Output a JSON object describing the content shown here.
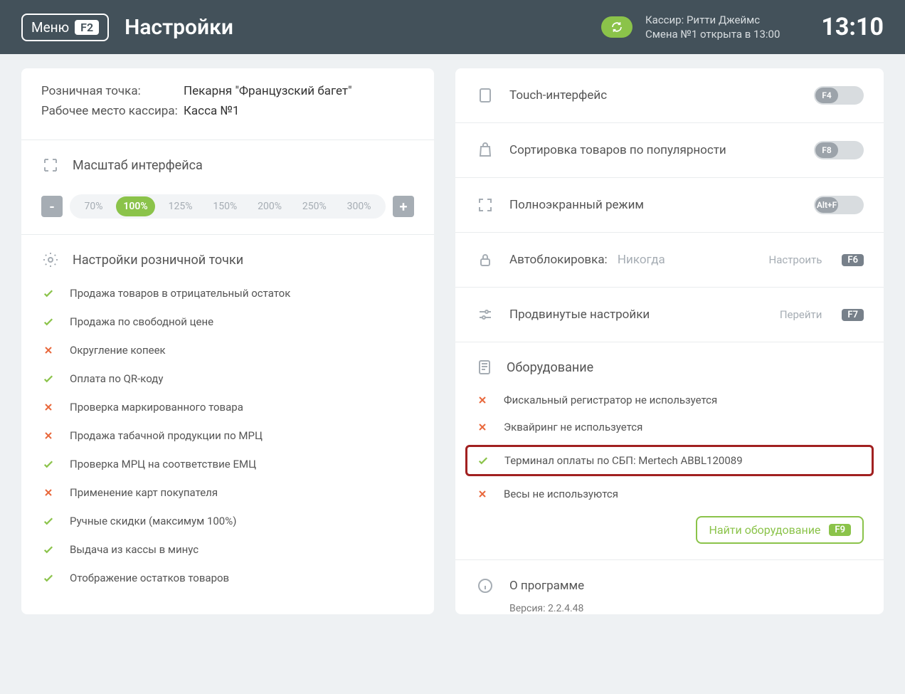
{
  "header": {
    "menu_label": "Меню",
    "menu_key": "F2",
    "title": "Настройки",
    "cashier_line1": "Кассир: Ритти Джеймс",
    "cashier_line2": "Смена №1 открыта в 13:00",
    "clock": "13:10"
  },
  "left": {
    "info": {
      "retail_label": "Розничная точка:",
      "retail_value": "Пекарня \"Французский багет\"",
      "workplace_label": "Рабочее место кассира:",
      "workplace_value": "Касса №1"
    },
    "scale": {
      "title": "Масштаб интерфейса",
      "minus": "-",
      "plus": "+",
      "options": [
        "70%",
        "100%",
        "125%",
        "150%",
        "200%",
        "250%",
        "300%"
      ],
      "active_index": 1
    },
    "point_settings": {
      "title": "Настройки розничной точки",
      "items": [
        {
          "ok": true,
          "text": "Продажа товаров в отрицательный остаток"
        },
        {
          "ok": true,
          "text": "Продажа по свободной цене"
        },
        {
          "ok": false,
          "text": "Округление копеек"
        },
        {
          "ok": true,
          "text": "Оплата по QR-коду"
        },
        {
          "ok": false,
          "text": "Проверка маркированного товара"
        },
        {
          "ok": false,
          "text": "Продажа табачной продукции по МРЦ"
        },
        {
          "ok": true,
          "text": "Проверка МРЦ на соответствие ЕМЦ"
        },
        {
          "ok": false,
          "text": "Применение карт покупателя"
        },
        {
          "ok": true,
          "text": "Ручные скидки (максимум 100%)"
        },
        {
          "ok": true,
          "text": "Выдача из кассы в минус"
        },
        {
          "ok": true,
          "text": "Отображение остатков товаров"
        }
      ]
    }
  },
  "right": {
    "touch": {
      "label": "Touch-интерфейс",
      "key": "F4"
    },
    "sort": {
      "label": "Сортировка товаров по популярности",
      "key": "F8"
    },
    "fullscreen": {
      "label": "Полноэкранный режим",
      "key": "Alt+F"
    },
    "autolock": {
      "label": "Автоблокировка:",
      "value": "Никогда",
      "link": "Настроить",
      "key": "F6"
    },
    "advanced": {
      "label": "Продвинутые настройки",
      "link": "Перейти",
      "key": "F7"
    },
    "equipment": {
      "title": "Оборудование",
      "items": [
        {
          "ok": false,
          "text": "Фискальный регистратор не используется"
        },
        {
          "ok": false,
          "text": "Эквайринг не используется"
        },
        {
          "ok": true,
          "text": "Терминал оплаты по СБП: Mertech ABBL120089",
          "highlight": true
        },
        {
          "ok": false,
          "text": "Весы не используются"
        }
      ],
      "find_label": "Найти оборудование",
      "find_key": "F9"
    },
    "about": {
      "label": "О программе",
      "version": "Версия: 2.2.4.48"
    }
  }
}
